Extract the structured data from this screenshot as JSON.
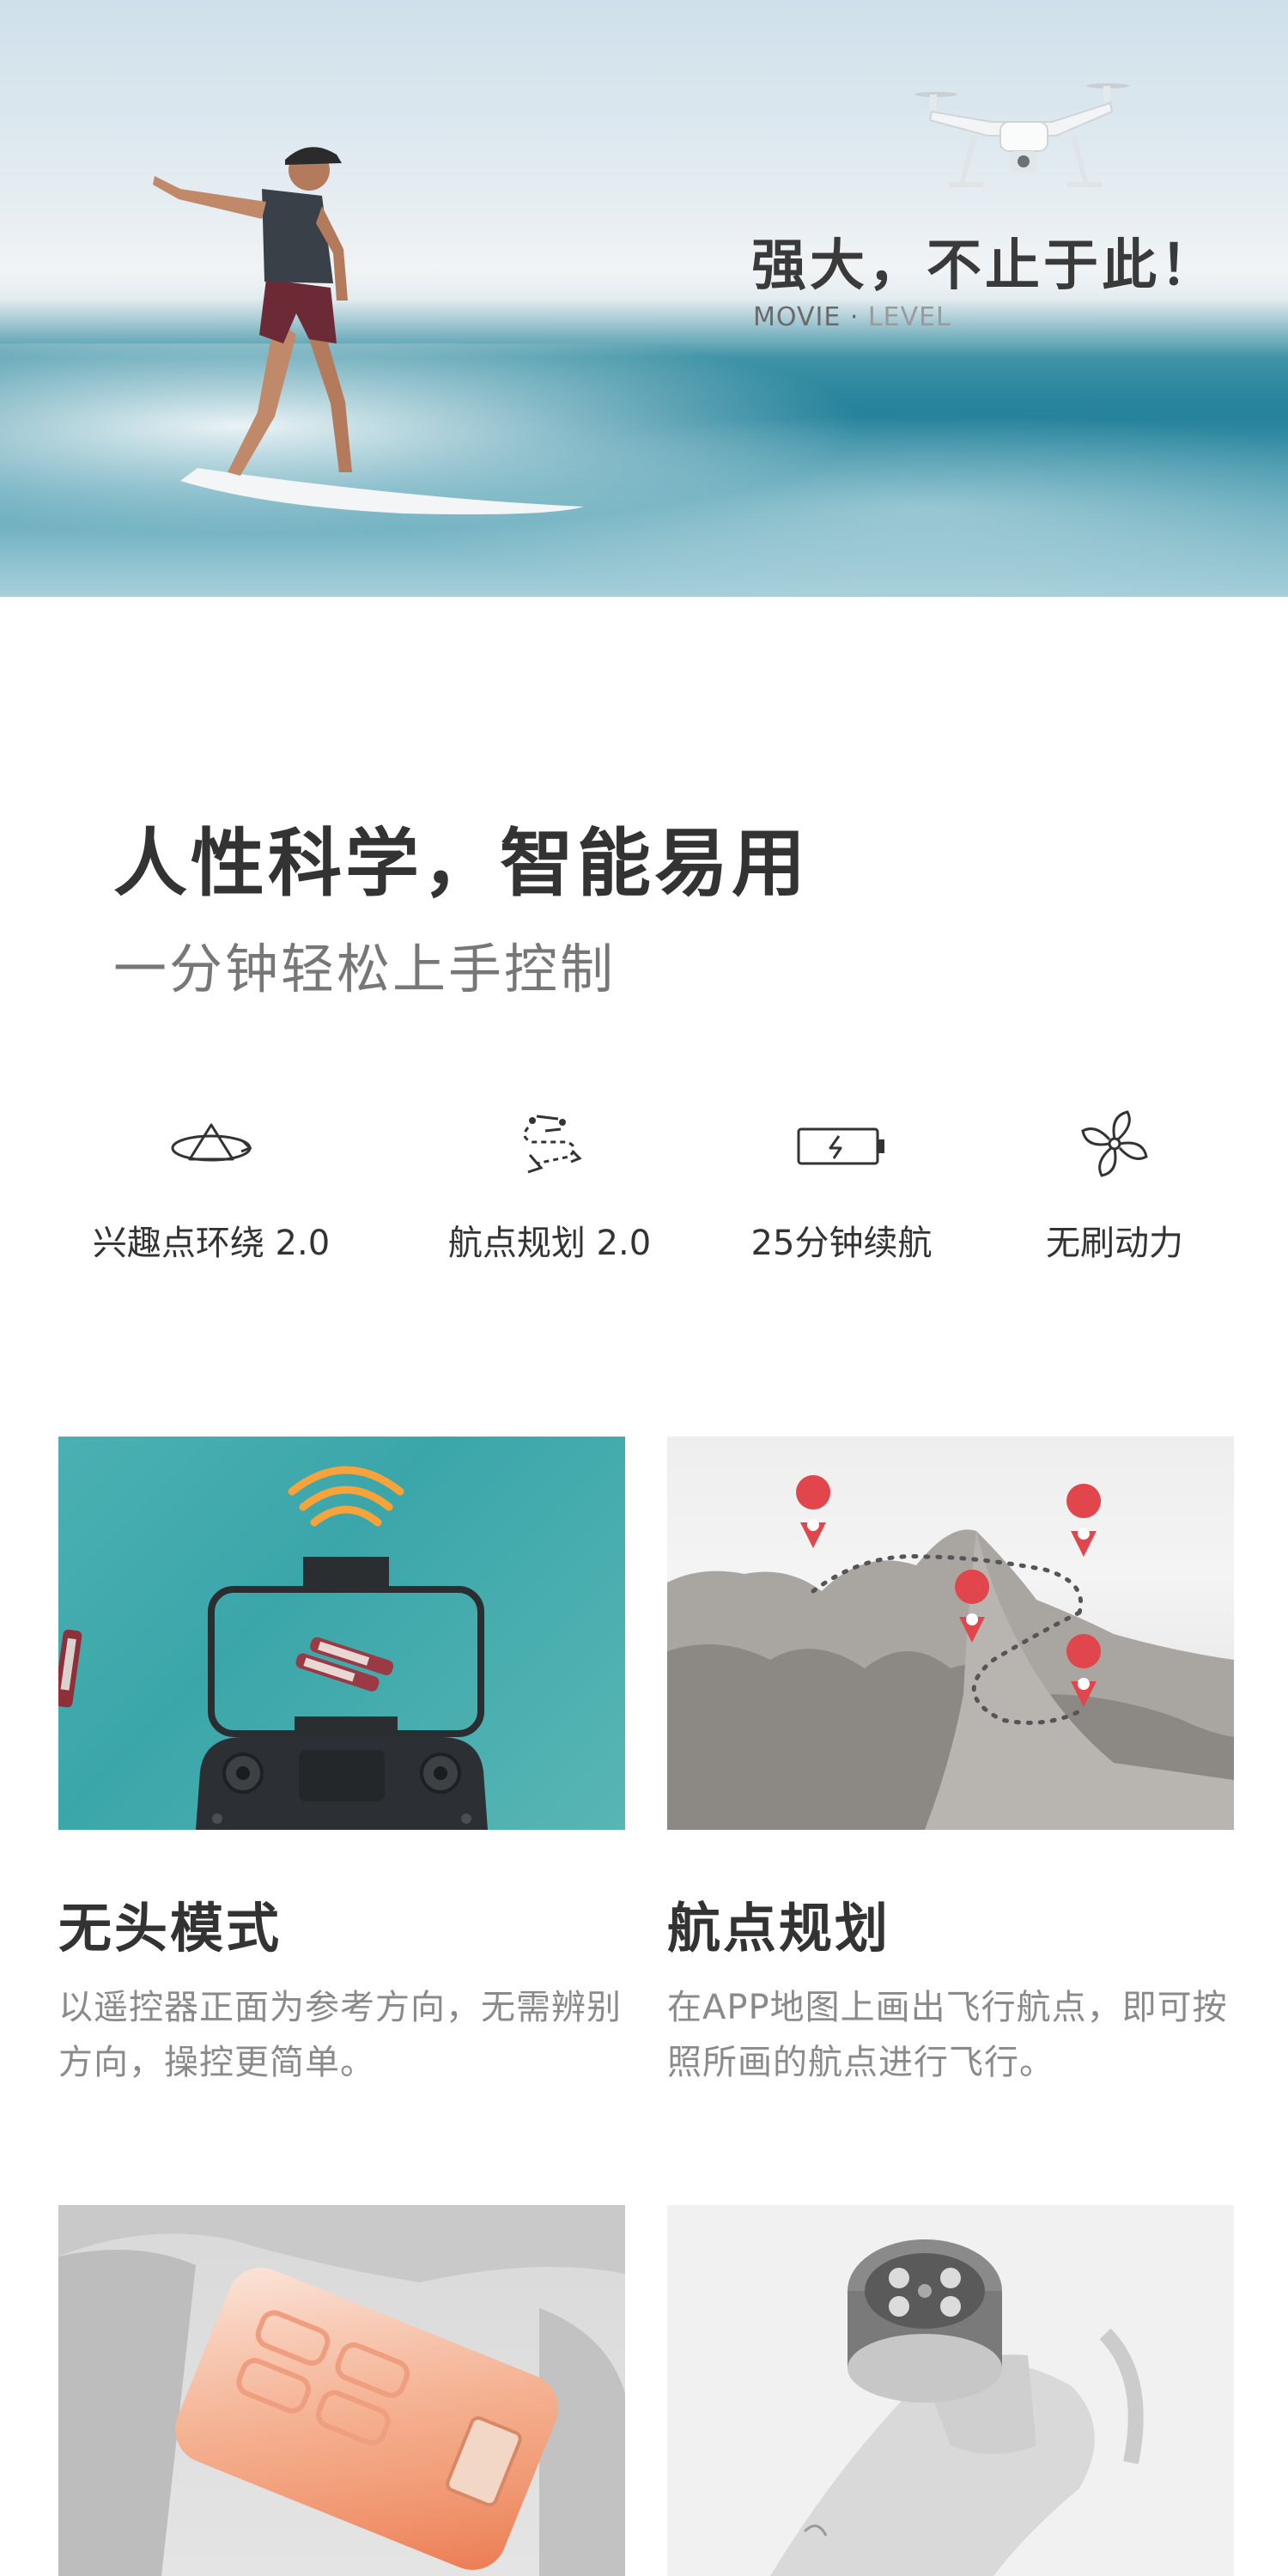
{
  "hero": {
    "title": "强大，不止于此！",
    "sub_movie": "MOVIE",
    "sub_dot": " · ",
    "sub_level": "LEVEL"
  },
  "intro": {
    "title": "人性科学，智能易用",
    "subtitle": "一分钟轻松上手控制"
  },
  "features": [
    {
      "label": "兴趣点环绕 2.0",
      "icon": "orbit-icon"
    },
    {
      "label": "航点规划 2.0",
      "icon": "waypoint-route-icon"
    },
    {
      "label": "25分钟续航",
      "icon": "battery-icon"
    },
    {
      "label": "无刷动力",
      "icon": "propeller-icon"
    }
  ],
  "cards": [
    {
      "title": "无头模式",
      "desc": "以遥控器正面为参考方向，无需辨别方向，操控更简单。"
    },
    {
      "title": "航点规划",
      "desc": "在APP地图上画出飞行航点，即可按照所画的航点进行飞行。"
    }
  ],
  "colors": {
    "pin_red": "#e0464b",
    "battery_orange": "#f08a5d",
    "wifi_orange": "#f5a33a",
    "sea": "#2a8ea5"
  }
}
